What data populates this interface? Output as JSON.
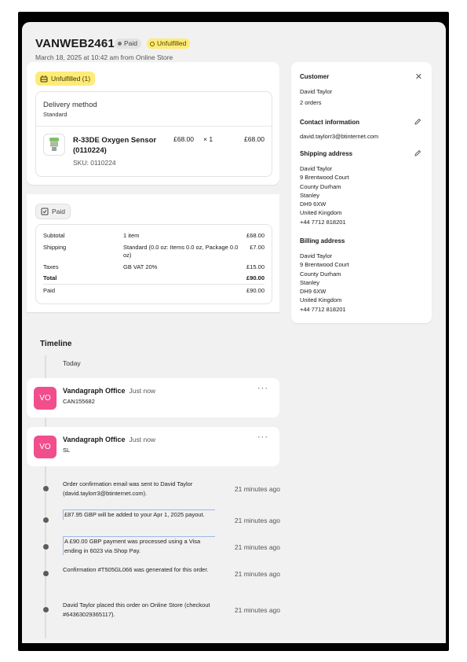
{
  "header": {
    "order_id": "VANWEB2461",
    "paid_badge": "Paid",
    "unfulfilled_badge": "Unfulfilled",
    "subtitle": "March 18, 2025 at 10:42 am from Online Store"
  },
  "fulfillment": {
    "status_label": "Unfulfilled (1)",
    "delivery_title": "Delivery method",
    "delivery_method": "Standard",
    "product": {
      "name": "R-33DE Oxygen Sensor (0110224)",
      "sku": "SKU: 0110224",
      "price": "£68.00",
      "quantity": "× 1",
      "total": "£68.00"
    }
  },
  "payment": {
    "status_label": "Paid",
    "rows": [
      {
        "label": "Subtotal",
        "detail": "1 item",
        "amount": "£68.00"
      },
      {
        "label": "Shipping",
        "detail": "Standard (0.0 oz: Items 0.0 oz, Package 0.0 oz)",
        "amount": "£7.00"
      },
      {
        "label": "Taxes",
        "detail": "GB VAT 20%",
        "amount": "£15.00"
      },
      {
        "label": "Total",
        "detail": "",
        "amount": "£90.00"
      },
      {
        "label": "Paid",
        "detail": "",
        "amount": "£90.00"
      }
    ]
  },
  "customer": {
    "heading": "Customer",
    "name": "David Taylor",
    "orders": "2 orders",
    "contact_heading": "Contact information",
    "email": "david.taylorr3@btinternet.com",
    "shipping_heading": "Shipping address",
    "shipping_lines": [
      "David Taylor",
      "9 Brentwood Court",
      "County Durham",
      "Stanley",
      "DH9 6XW",
      "United Kingdom",
      "+44 7712 818201"
    ],
    "billing_heading": "Billing address",
    "billing_lines": [
      "David Taylor",
      "9 Brentwood Court",
      "County Durham",
      "Stanley",
      "DH9 6XW",
      "United Kingdom",
      "+44 7712 818201"
    ]
  },
  "timeline": {
    "title": "Timeline",
    "today": "Today",
    "comments": [
      {
        "initials": "VO",
        "author": "Vandagraph Office",
        "time": "Just now",
        "body": "CAN155682"
      },
      {
        "initials": "VO",
        "author": "Vandagraph Office",
        "time": "Just now",
        "body": "SL"
      }
    ],
    "events": [
      {
        "text": "Order confirmation email was sent to David Taylor (david.taylorr3@btinternet.com).",
        "time": "21 minutes ago"
      },
      {
        "text": "£87.95 GBP will be added to your Apr 1, 2025 payout.",
        "time": "21 minutes ago"
      },
      {
        "text": "A £90.00 GBP payment was processed using a Visa ending in 6023 via Shop Pay.",
        "time": "21 minutes ago"
      },
      {
        "text": "Confirmation #T505GL066 was generated for this order.",
        "time": "21 minutes ago"
      },
      {
        "text": "David Taylor placed this order on Online Store (checkout #64363029365117).",
        "time": "21 minutes ago"
      }
    ]
  }
}
